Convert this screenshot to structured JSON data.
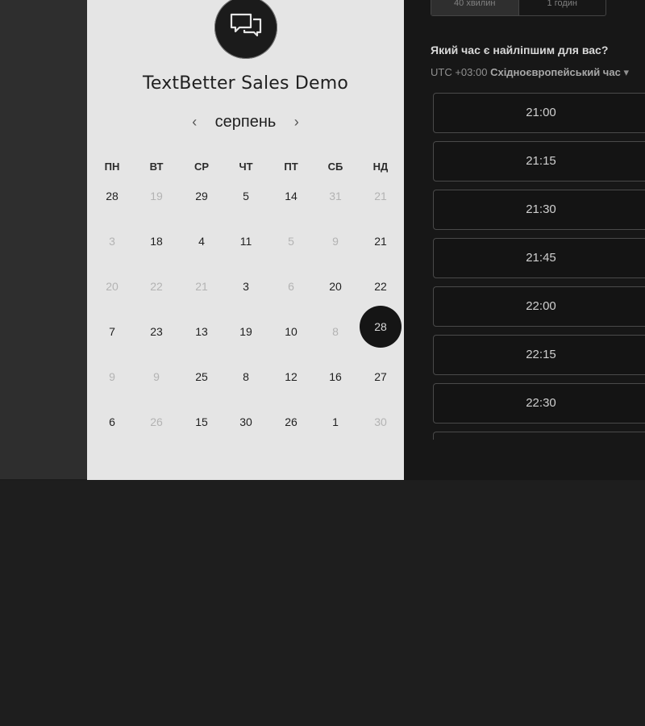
{
  "event": {
    "title": "TextBetter Sales Demo",
    "logo_icon": "chat-bubbles-icon"
  },
  "calendar": {
    "month": "серпень",
    "prev_icon": "chevron-left-icon",
    "next_icon": "chevron-right-icon",
    "weekdays": [
      "ПН",
      "ВТ",
      "СР",
      "ЧТ",
      "ПТ",
      "СБ",
      "НД"
    ],
    "weeks": [
      [
        {
          "d": "28",
          "muted": false
        },
        {
          "d": "19",
          "muted": true
        },
        {
          "d": "29",
          "muted": false
        },
        {
          "d": "5",
          "muted": false
        },
        {
          "d": "14",
          "muted": false
        },
        {
          "d": "31",
          "muted": true
        },
        {
          "d": "21",
          "muted": true
        }
      ],
      [
        {
          "d": "3",
          "muted": true
        },
        {
          "d": "18",
          "muted": false
        },
        {
          "d": "4",
          "muted": false
        },
        {
          "d": "11",
          "muted": false
        },
        {
          "d": "5",
          "muted": true
        },
        {
          "d": "9",
          "muted": true
        },
        {
          "d": "21",
          "muted": false
        }
      ],
      [
        {
          "d": "20",
          "muted": true
        },
        {
          "d": "22",
          "muted": true
        },
        {
          "d": "21",
          "muted": true
        },
        {
          "d": "3",
          "muted": false
        },
        {
          "d": "6",
          "muted": true
        },
        {
          "d": "20",
          "muted": false
        },
        {
          "d": "22",
          "muted": false
        }
      ],
      [
        {
          "d": "7",
          "muted": false
        },
        {
          "d": "23",
          "muted": false
        },
        {
          "d": "13",
          "muted": false
        },
        {
          "d": "19",
          "muted": false
        },
        {
          "d": "10",
          "muted": false
        },
        {
          "d": "8",
          "muted": true
        },
        {
          "d": "28",
          "muted": false,
          "selected": true
        }
      ],
      [
        {
          "d": "9",
          "muted": true
        },
        {
          "d": "9",
          "muted": true
        },
        {
          "d": "25",
          "muted": false
        },
        {
          "d": "8",
          "muted": false
        },
        {
          "d": "12",
          "muted": false
        },
        {
          "d": "16",
          "muted": false
        },
        {
          "d": "27",
          "muted": false
        }
      ],
      [
        {
          "d": "6",
          "muted": false
        },
        {
          "d": "26",
          "muted": true
        },
        {
          "d": "15",
          "muted": false
        },
        {
          "d": "30",
          "muted": false
        },
        {
          "d": "26",
          "muted": false
        },
        {
          "d": "1",
          "muted": false
        },
        {
          "d": "30",
          "muted": true
        }
      ]
    ]
  },
  "duration": {
    "options": [
      "40 хвилин",
      "1 годин"
    ]
  },
  "booking": {
    "question": "Який час є найліпшим для вас?",
    "timezone_offset": "UTC +03:00",
    "timezone_name": "Східноєвропейський час",
    "slots": [
      "21:00",
      "21:15",
      "21:30",
      "21:45",
      "22:00",
      "22:15",
      "22:30"
    ]
  }
}
